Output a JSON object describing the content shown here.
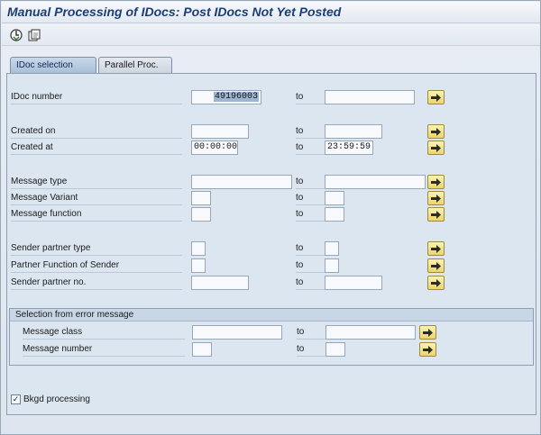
{
  "window": {
    "title": "Manual Processing of IDocs: Post IDocs Not Yet Posted"
  },
  "toolbar": {
    "buttons": [
      {
        "name": "execute-button",
        "icon": "execute-icon"
      },
      {
        "name": "get-variant-button",
        "icon": "get-variant-icon"
      }
    ]
  },
  "tabs": [
    {
      "label": "IDoc selection",
      "active": true
    },
    {
      "label": "Parallel Proc.",
      "active": false
    }
  ],
  "fields": {
    "to_label": "to",
    "idoc_number": {
      "label": "IDoc number",
      "from": "49196003",
      "to": ""
    },
    "created_on": {
      "label": "Created on",
      "from": "",
      "to": ""
    },
    "created_at": {
      "label": "Created at",
      "from": "00:00:00",
      "to": "23:59:59"
    },
    "message_type": {
      "label": "Message type",
      "from": "",
      "to": ""
    },
    "message_variant": {
      "label": "Message Variant",
      "from": "",
      "to": ""
    },
    "message_function": {
      "label": "Message function",
      "from": "",
      "to": ""
    },
    "sender_partner_type": {
      "label": "Sender partner type",
      "from": "",
      "to": ""
    },
    "partner_function_sender": {
      "label": "Partner Function of Sender",
      "from": "",
      "to": ""
    },
    "sender_partner_no": {
      "label": "Sender partner no.",
      "from": "",
      "to": ""
    }
  },
  "error_group": {
    "title": "Selection from error message",
    "message_class": {
      "label": "Message class",
      "from": "",
      "to": ""
    },
    "message_number": {
      "label": "Message number",
      "from": "",
      "to": ""
    }
  },
  "options": {
    "bkgd_processing": {
      "label": "Bkgd processing",
      "checked": true,
      "mark": "✓"
    }
  },
  "colors": {
    "title_text": "#1c3e73",
    "panel_bg": "#dce6f0",
    "multi_select_button": "#ecd56b"
  }
}
